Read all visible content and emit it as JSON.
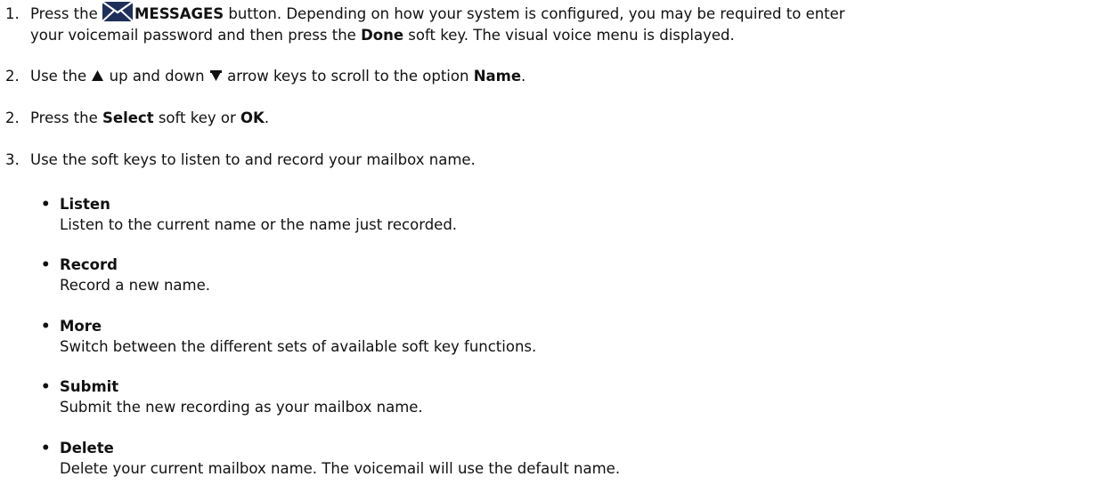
{
  "steps": [
    {
      "number": "1.",
      "pre": "Press the ",
      "icon": "envelope-icon",
      "bold": "MESSAGES",
      "mid": " button. Depending on how your system is configured, you may be required to enter",
      "line2_pre": "your voicemail password and then press the ",
      "line2_bold": "Done",
      "line2_post": " soft key. The visual voice menu is displayed."
    },
    {
      "number": "2.",
      "pre": "Use the ",
      "up_icon": "up-arrow-icon",
      "mid": " up and down ",
      "down_icon": "down-arrow-icon",
      "post": " arrow keys to scroll to the option ",
      "bold": "Name",
      "end": "."
    },
    {
      "number": "2.",
      "pre": "Press the ",
      "bold1": "Select",
      "mid": " soft key or ",
      "bold2": "OK",
      "end": "."
    },
    {
      "number": "3.",
      "text": "Use the soft keys to listen to and record your mailbox name."
    }
  ],
  "softkeys": [
    {
      "bullet": "•",
      "name": "Listen",
      "description": "Listen to the current name or the name just recorded."
    },
    {
      "bullet": "•",
      "name": "Record",
      "description": "Record a new name."
    },
    {
      "bullet": "•",
      "name": "More",
      "description": "Switch between the different sets of available soft key functions."
    },
    {
      "bullet": "•",
      "name": "Submit",
      "description": "Submit the new recording as your mailbox name."
    },
    {
      "bullet": "•",
      "name": "Delete",
      "description": "Delete your current mailbox name. The voicemail will use the default name."
    }
  ]
}
